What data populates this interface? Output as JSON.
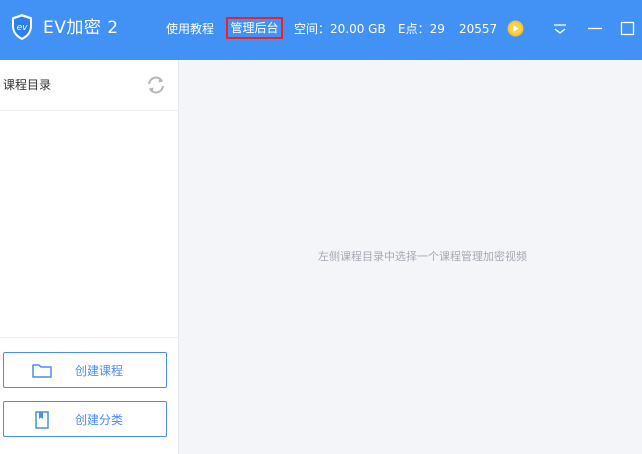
{
  "app": {
    "title": "EV加密 2",
    "logo_text": "ev"
  },
  "header": {
    "nav": {
      "tutorial": "使用教程",
      "admin": "管理后台"
    },
    "stats": {
      "space": "空间：20.00 GB",
      "points": "E点：29",
      "number": "20557"
    },
    "icons": {
      "coin": "coin-icon",
      "menu": "dropdown-menu-icon",
      "minimize": "minimize-icon",
      "maximize": "maximize-icon"
    }
  },
  "sidebar": {
    "title": "课程目录",
    "buttons": {
      "create_course": "创建课程",
      "create_category": "创建分类"
    }
  },
  "main": {
    "empty_hint": "左侧课程目录中选择一个课程管理加密视频"
  },
  "colors": {
    "header_bg": "#4291f4",
    "accent": "#4a8cf0",
    "highlight_border": "#e8232e",
    "coin": "#f7c423"
  }
}
